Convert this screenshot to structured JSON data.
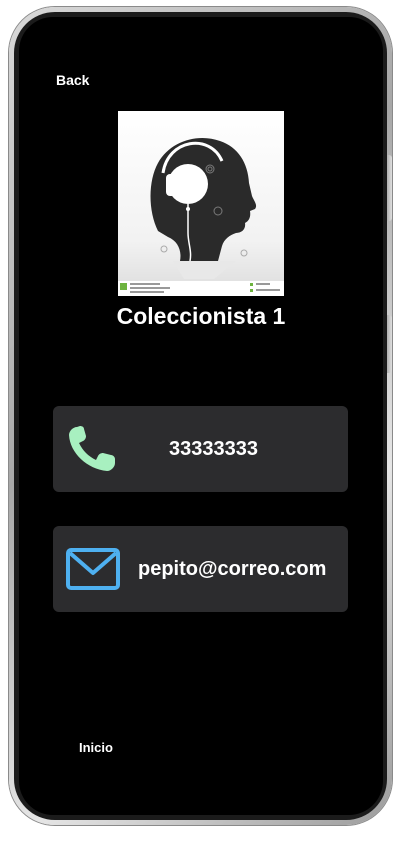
{
  "nav": {
    "back_label": "Back",
    "home_label": "Inicio"
  },
  "profile": {
    "name": "Coleccionista 1",
    "avatar_icon": "head-with-headphones-image",
    "phone": "33333333",
    "email": "pepito@correo.com"
  },
  "icons": {
    "phone": "phone-icon",
    "email": "mail-icon"
  },
  "colors": {
    "background": "#000000",
    "card": "#2c2c2e",
    "phone_icon": "#a8f0c0",
    "mail_icon": "#4eb0f0",
    "text": "#ffffff"
  }
}
